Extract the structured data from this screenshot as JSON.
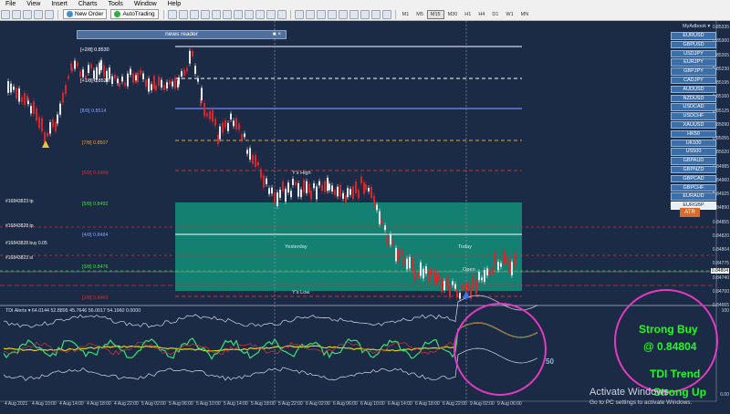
{
  "menu": [
    "File",
    "View",
    "Insert",
    "Charts",
    "Tools",
    "Window",
    "Help"
  ],
  "toolbar": {
    "new_order": "New Order",
    "auto_trading": "AutoTrading",
    "timeframes": [
      "M1",
      "M5",
      "M15",
      "M30",
      "H1",
      "H4",
      "D1",
      "W1",
      "MN"
    ],
    "selected_timeframe": "M15"
  },
  "news_reader": {
    "title": "news reader"
  },
  "fib_levels": [
    {
      "label": "[+2/8]  0.8530",
      "color": "#ffffff"
    },
    {
      "label": "[+1/8]  0.8522",
      "color": "#ffffff"
    },
    {
      "label": "[8/8]  0.8514",
      "color": "#7fa0ff"
    },
    {
      "label": "[7/8]  0.8507",
      "color": "#e8a040"
    },
    {
      "label": "[6/8]  0.8499",
      "color": "#d03030"
    },
    {
      "label": "[5/8]  0.8492",
      "color": "#40e040"
    },
    {
      "label": "[4/8]  0.8484",
      "color": "#7fa0ff"
    },
    {
      "label": "[3/8]  0.8476",
      "color": "#40e040"
    },
    {
      "label": "[2/8]  0.8469",
      "color": "#d03030"
    }
  ],
  "chart_labels": {
    "ys_high": "Y's High",
    "yesterday": "Yesterday",
    "today": "Today",
    "open": "Open",
    "ys_low": "Y's Low"
  },
  "orders": [
    "#16843823 tp",
    "#16843828 tp",
    "#16843828 buy 0.05",
    "#16843823 sl"
  ],
  "price_axis": [
    "0.85335",
    "0.85300",
    "0.85265",
    "0.85230",
    "0.85195",
    "0.85160",
    "0.85125",
    "0.85090",
    "0.85055",
    "0.85020",
    "0.84985",
    "0.84960",
    "0.84925",
    "0.84890",
    "0.84855",
    "0.84820",
    "0.84804",
    "0.84775",
    "0.84740",
    "0.84700",
    "0.84665"
  ],
  "current_price": "0.84804",
  "time_axis": [
    "4 Aug 2021",
    "4 Aug 10:00",
    "4 Aug 14:00",
    "4 Aug 18:00",
    "4 Aug 22:00",
    "5 Aug 02:00",
    "5 Aug 06:00",
    "5 Aug 10:00",
    "5 Aug 14:00",
    "5 Aug 18:00",
    "5 Aug 22:00",
    "6 Aug 02:00",
    "6 Aug 06:00",
    "6 Aug 10:00",
    "6 Aug 14:00",
    "6 Aug 18:00",
    "6 Aug 22:00",
    "9 Aug 02:00",
    "9 Aug 06:00"
  ],
  "indicator": {
    "title": "TDI Alerts ▾ 64.0144 52.8895 45.7646 56.0017 54.1960 0.0000",
    "level_label": "50",
    "axis_top": "100",
    "axis_bottom": "0.00"
  },
  "market_watch": {
    "title": "MyAdbook ▾",
    "symbols": [
      "EURUSD",
      "GBPUSD",
      "USDJPY",
      "EURJPY",
      "GBPJPY",
      "CADJPY",
      "AUDUSD",
      "NZDUSD",
      "USDCAD",
      "USDCHF",
      "XAUUSD",
      "HK50",
      "UK100",
      "US500",
      "GBPAUD",
      "GBPNZD",
      "GBPCAD",
      "GBPCHF",
      "EURAUD",
      "EURGBP"
    ],
    "active": "EURGBP",
    "atr_button": "ATR"
  },
  "annotation": {
    "line1": "Strong Buy",
    "line2": "@ 0.84804",
    "line3": "TDI Trend",
    "line4": "Strong Up"
  },
  "watermark": {
    "title": "Activate Windows",
    "subtitle": "Go to PC settings to activate Windows."
  },
  "colors": {
    "background": "#16263f",
    "bull": "#e8e8e8",
    "bear": "#d8262c",
    "zone": "#138f7a",
    "tdi_green": "#39e27a",
    "tdi_yellow": "#e2d41c",
    "circle": "#e23bbf",
    "annotation_text": "#1aff1a"
  }
}
